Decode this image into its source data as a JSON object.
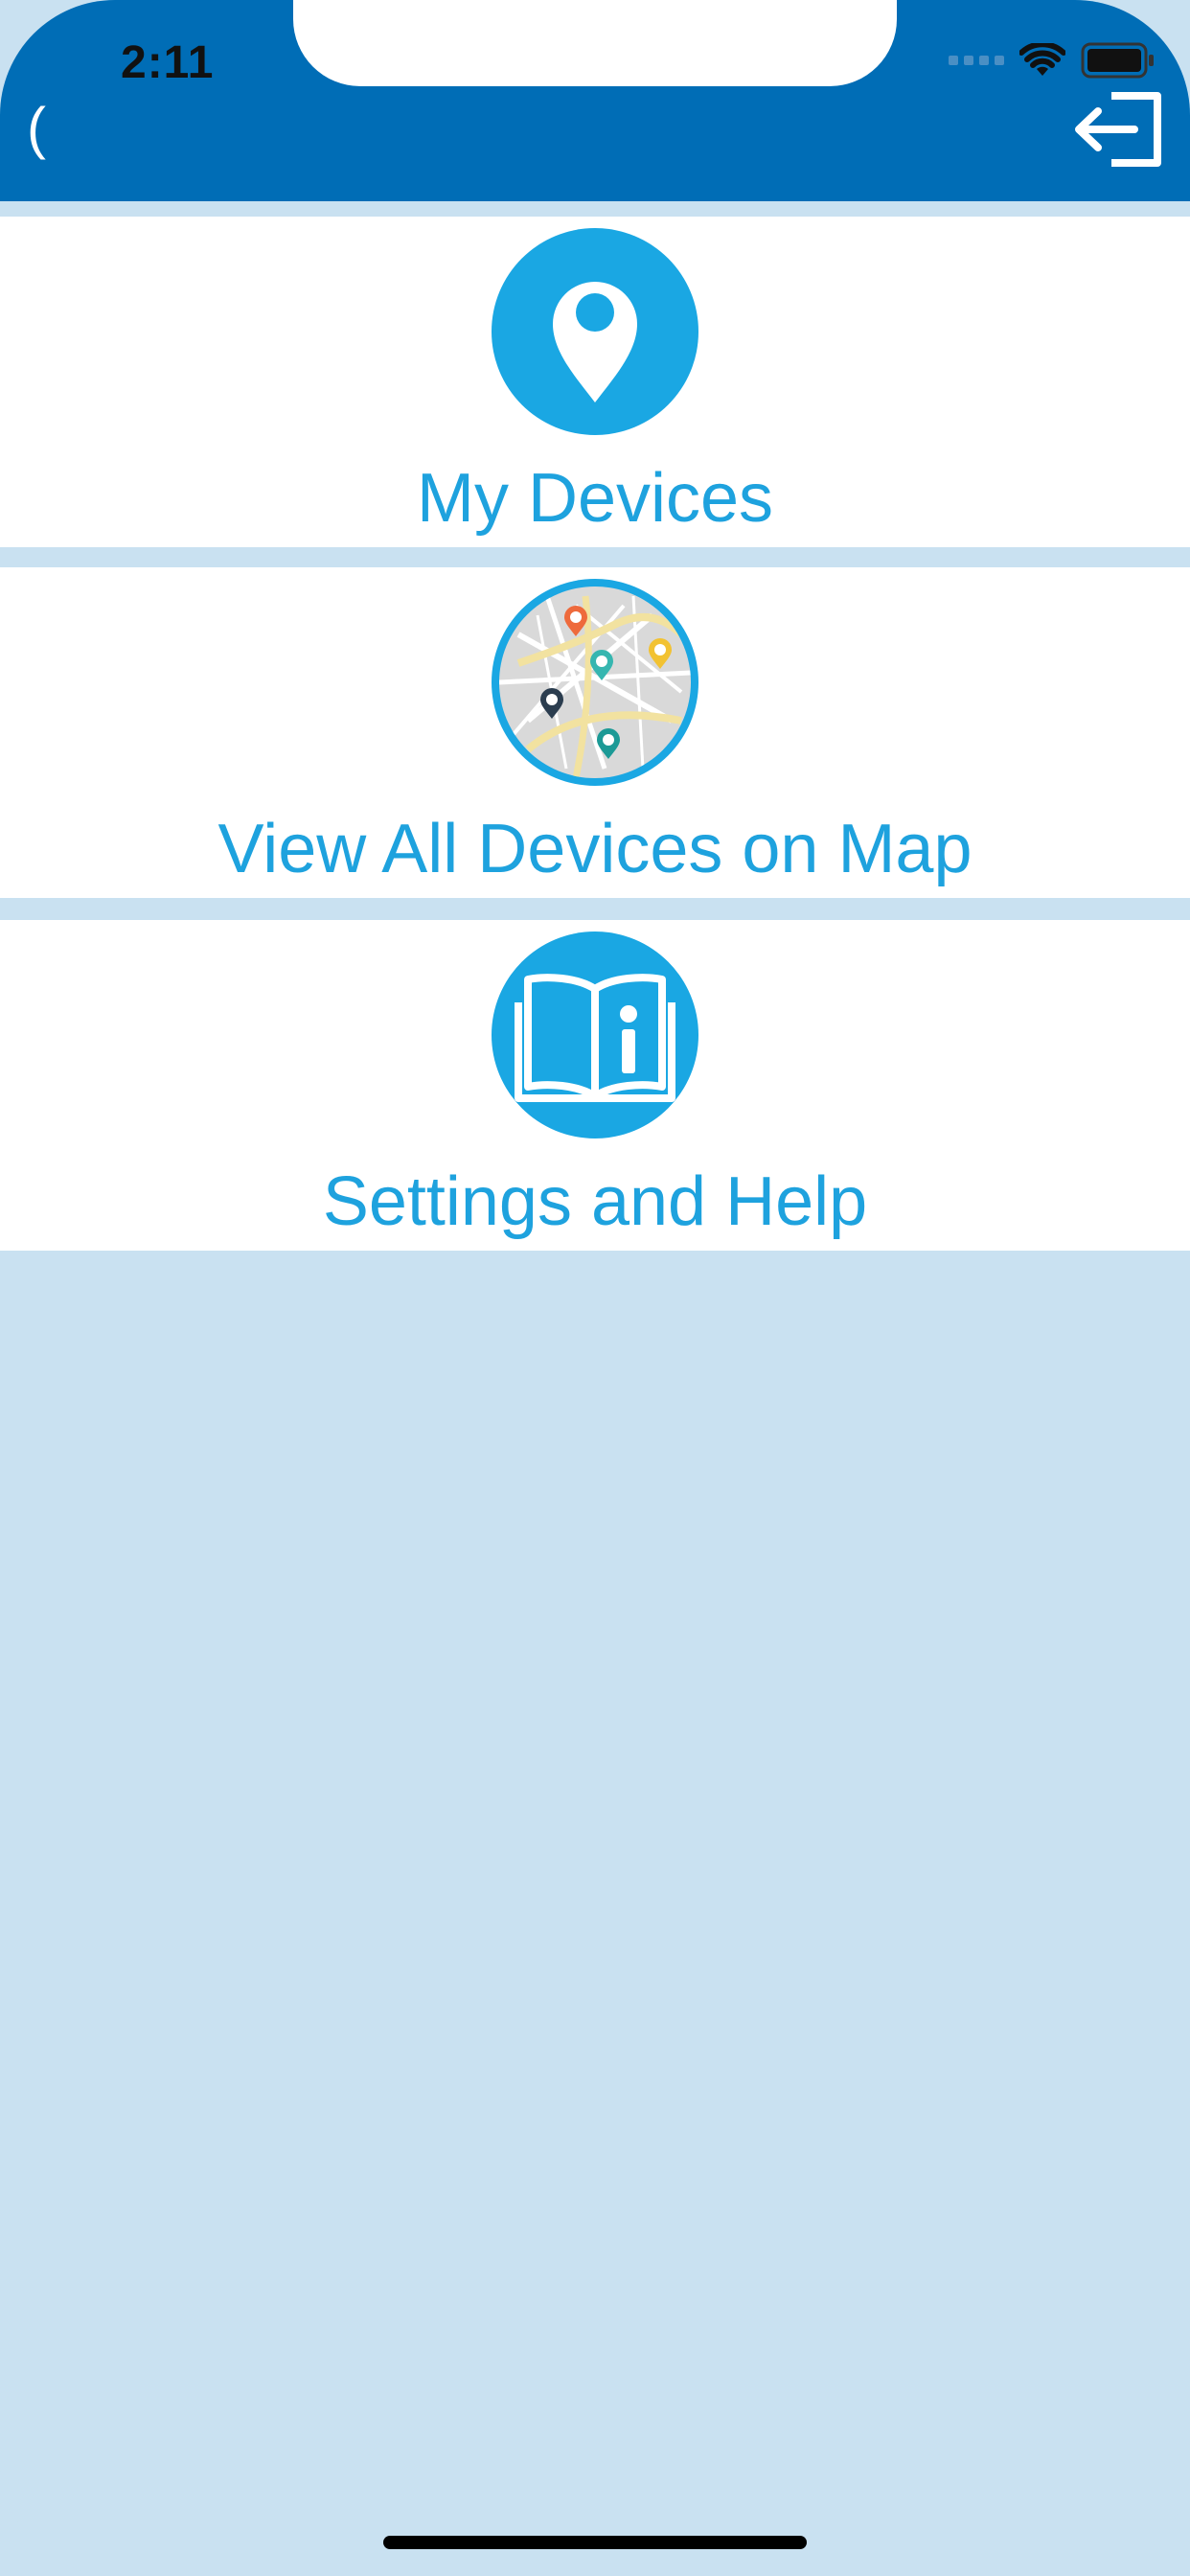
{
  "status_bar": {
    "time": "2:11",
    "icons": [
      "signal-dots-icon",
      "wifi-icon",
      "battery-icon"
    ]
  },
  "nav": {
    "back_glyph": "(",
    "logout_icon": "logout-icon"
  },
  "menu": {
    "items": [
      {
        "label": "My Devices",
        "icon": "location-pin-icon"
      },
      {
        "label": "View All Devices on Map",
        "icon": "map-icon"
      },
      {
        "label": "Settings and Help",
        "icon": "info-book-icon"
      }
    ]
  },
  "colors": {
    "header": "#006db6",
    "accent": "#1ea2de",
    "background": "#c9e1f1"
  }
}
